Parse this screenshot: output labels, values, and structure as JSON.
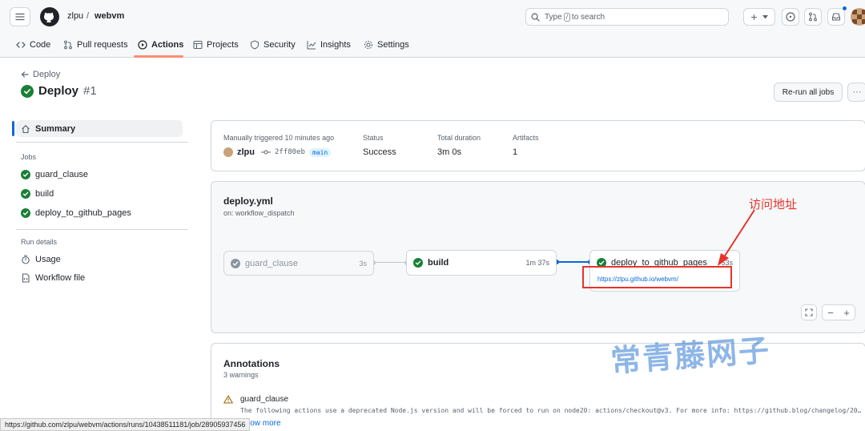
{
  "header": {
    "owner": "zlpu",
    "separator": "/",
    "repo": "webvm",
    "search_prefix": "Type",
    "search_key": "/",
    "search_suffix": "to search",
    "plus_label": "+"
  },
  "tabs": [
    {
      "label": "Code"
    },
    {
      "label": "Pull requests"
    },
    {
      "label": "Actions"
    },
    {
      "label": "Projects"
    },
    {
      "label": "Security"
    },
    {
      "label": "Insights"
    },
    {
      "label": "Settings"
    }
  ],
  "run": {
    "back_label": "Deploy",
    "title": "Deploy",
    "number": "#1",
    "rerun_label": "Re-run all jobs",
    "more_label": "···"
  },
  "sidebar": {
    "summary_label": "Summary",
    "jobs_heading": "Jobs",
    "jobs": [
      "guard_clause",
      "build",
      "deploy_to_github_pages"
    ],
    "run_details_heading": "Run details",
    "usage_label": "Usage",
    "workflow_file_label": "Workflow file"
  },
  "summary": {
    "trigger_label": "Manually triggered 10 minutes ago",
    "actor": "zlpu",
    "commit_sha": "2ff80eb",
    "branch": "main",
    "status_label": "Status",
    "status_value": "Success",
    "duration_label": "Total duration",
    "duration_value": "3m 0s",
    "artifacts_label": "Artifacts",
    "artifacts_value": "1"
  },
  "workflow": {
    "file": "deploy.yml",
    "trigger": "on: workflow_dispatch",
    "jobs": [
      {
        "name": "guard_clause",
        "duration": "3s"
      },
      {
        "name": "build",
        "duration": "1m 37s"
      },
      {
        "name": "deploy_to_github_pages",
        "duration": "53s"
      }
    ],
    "deploy_url": "https://zlpu.github.io/webvm/",
    "zoom_out": "−",
    "zoom_in": "+"
  },
  "annotation_callout": "访问地址",
  "watermark": "常青藤网子",
  "annotations": {
    "title": "Annotations",
    "count": "3 warnings",
    "item_title": "guard_clause",
    "item_message": "The following actions use a deprecated Node.js version and will be forced to run on node20: actions/checkout@v3. For more info: https://github.blog/changelog/20…",
    "show_more": "Show more"
  },
  "status_bar_url": "https://github.com/zlpu/webvm/actions/runs/10438511181/job/28905937456",
  "colors": {
    "success": "#1a7f37",
    "accent": "#0969da",
    "callout_red": "#e5342b",
    "tab_underline": "#fd8c73",
    "watermark": "#1f6fd0"
  }
}
